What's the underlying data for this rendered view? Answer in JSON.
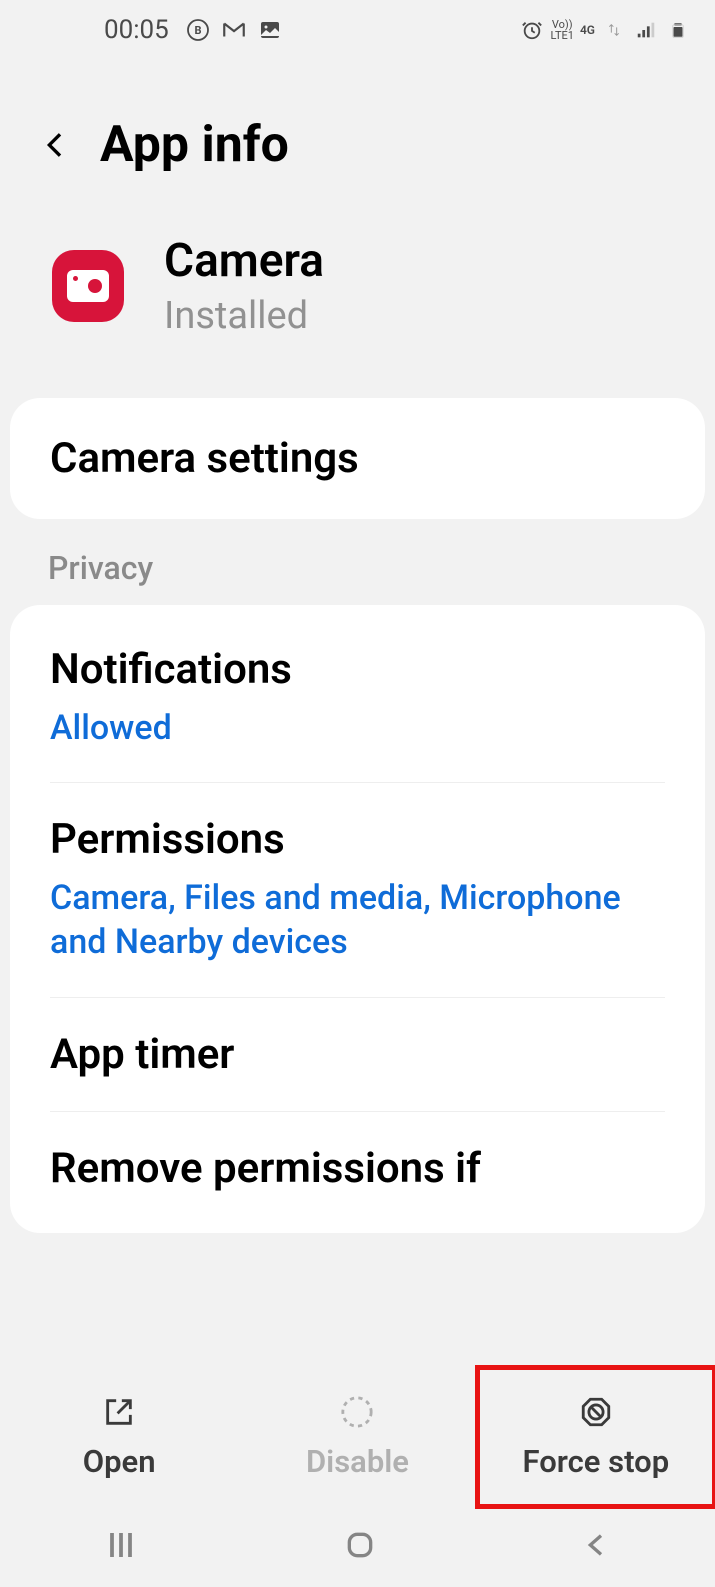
{
  "status": {
    "time": "00:05",
    "network": "4G",
    "volte": "LTE1"
  },
  "header": {
    "title": "App info"
  },
  "app": {
    "name": "Camera",
    "status": "Installed"
  },
  "settings": {
    "camera_settings": "Camera settings"
  },
  "sections": {
    "privacy": "Privacy"
  },
  "items": {
    "notifications": {
      "title": "Notifications",
      "value": "Allowed"
    },
    "permissions": {
      "title": "Permissions",
      "value": "Camera, Files and media, Microphone and Nearby devices"
    },
    "app_timer": {
      "title": "App timer"
    },
    "remove_permissions": {
      "title": "Remove permissions if"
    }
  },
  "actions": {
    "open": "Open",
    "disable": "Disable",
    "force_stop": "Force stop"
  }
}
